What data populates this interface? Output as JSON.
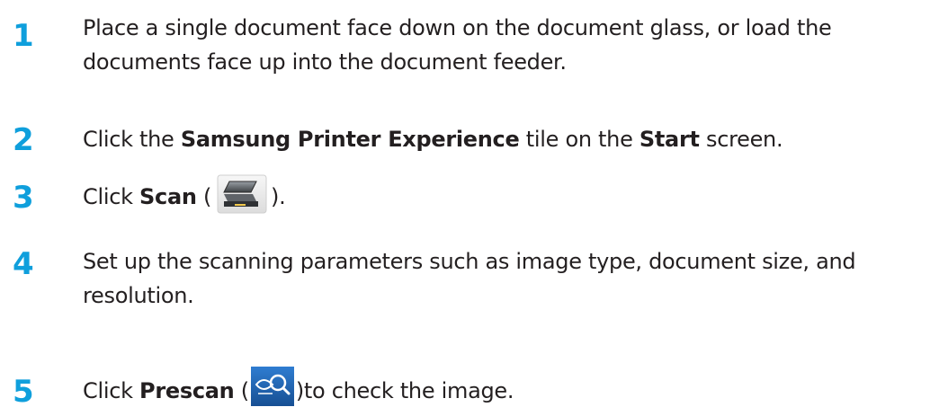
{
  "steps": [
    {
      "number": "1",
      "text": "Place a single document face down on the document glass, or load the documents face up into the document feeder."
    },
    {
      "number": "2",
      "pre": "Click the ",
      "bold1": "Samsung Printer Experience",
      "mid": " tile on the ",
      "bold2": "Start",
      "post": " screen."
    },
    {
      "number": "3",
      "pre": "Click ",
      "bold": "Scan",
      "open": " (",
      "icon": "scanner-icon",
      "close": ")."
    },
    {
      "number": "4",
      "text": "Set up the scanning parameters such as image type, document size, and resolution."
    },
    {
      "number": "5",
      "pre": "Click ",
      "bold": "Prescan",
      "open": " (",
      "icon": "prescan-magnifier-icon",
      "close": ")to check the image."
    }
  ],
  "colors": {
    "step_number": "#0f9fdc",
    "text": "#231f20",
    "prescan_icon_bg": "#1b5fa8"
  }
}
